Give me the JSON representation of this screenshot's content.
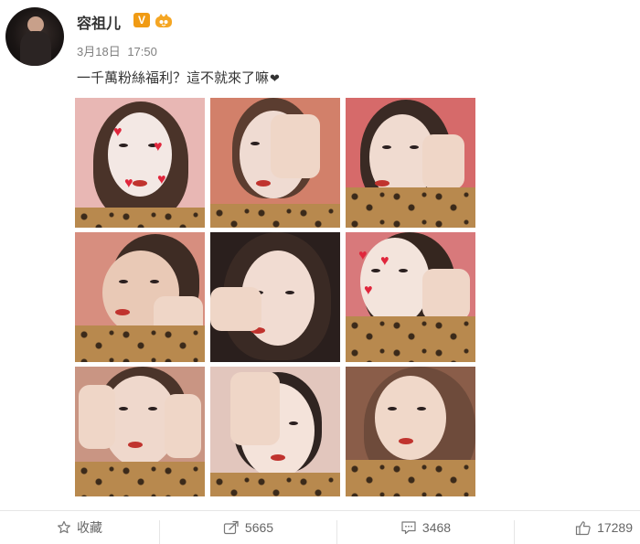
{
  "user": {
    "name": "容祖儿",
    "verified_label": "V",
    "avatar_icon": "avatar-photo",
    "crown_icon": "crown-badge-icon"
  },
  "post": {
    "date": "3月18日",
    "time": "17:50",
    "text": "一千萬粉絲福利？這不就來了嘛",
    "text_suffix_icon": "black-heart-icon",
    "text_suffix_glyph": "❤"
  },
  "actions": {
    "favorite": {
      "label": "收藏",
      "icon": "star-icon"
    },
    "repost": {
      "count": "5665",
      "icon": "share-icon"
    },
    "comment": {
      "count": "3468",
      "icon": "comment-icon"
    },
    "like": {
      "count": "17289",
      "icon": "thumbs-up-icon"
    }
  },
  "colors": {
    "badge": "#f09b14",
    "text": "#333333",
    "muted": "#808080"
  }
}
